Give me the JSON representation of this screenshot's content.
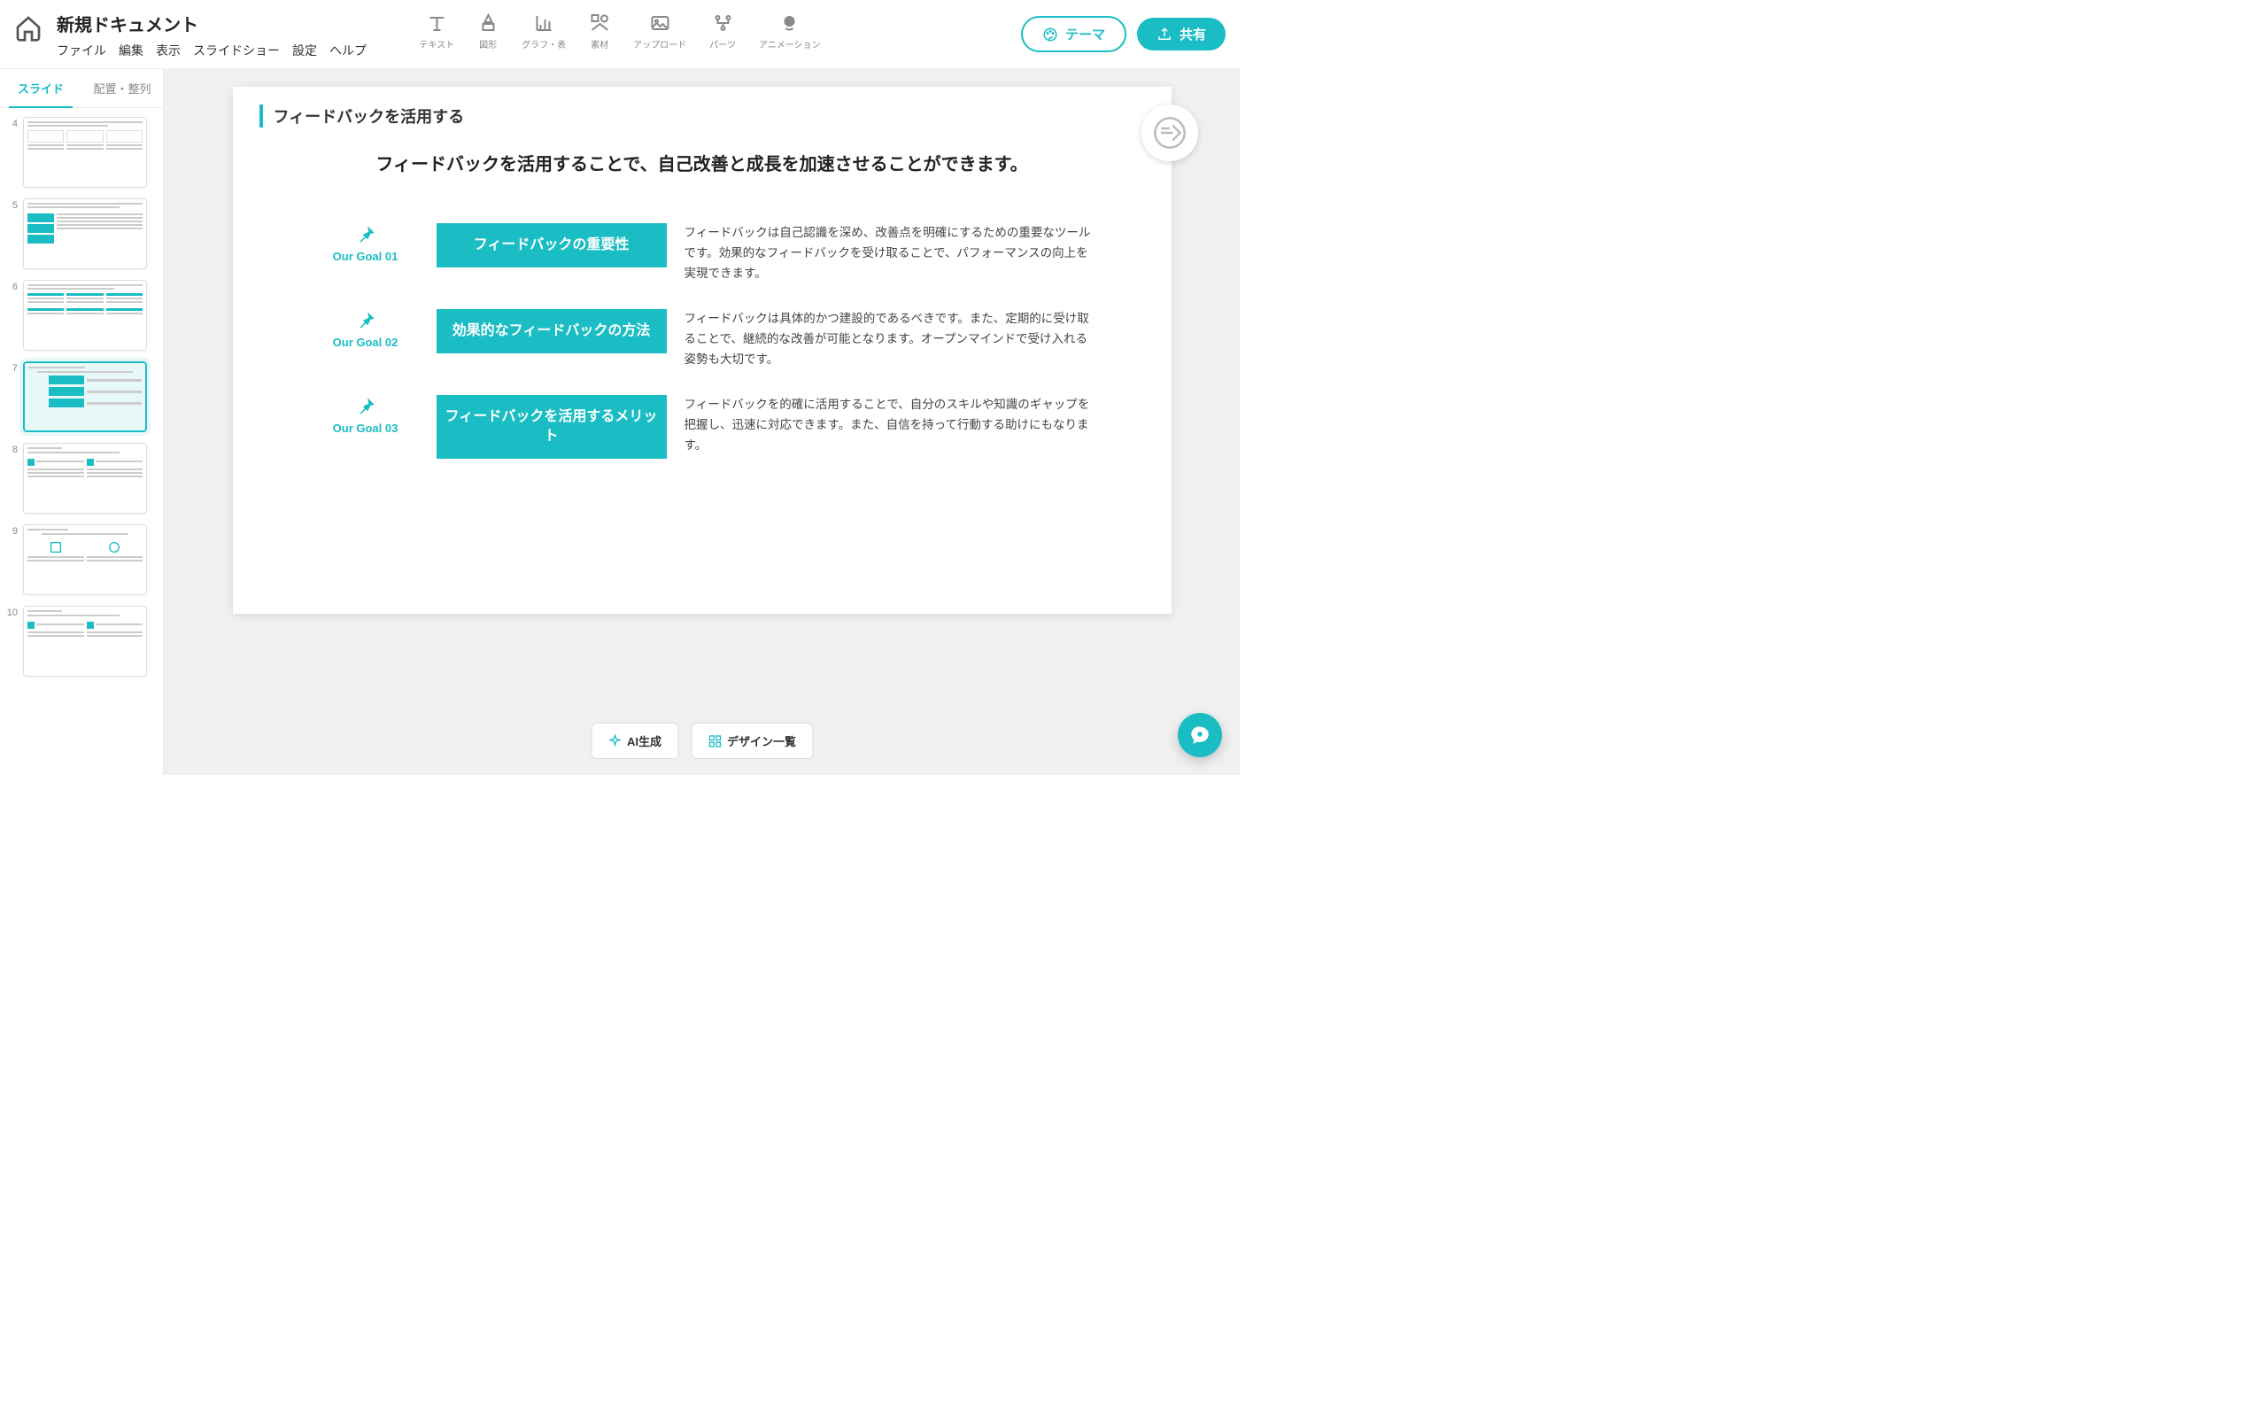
{
  "header": {
    "doc_title": "新規ドキュメント",
    "menu": {
      "file": "ファイル",
      "edit": "編集",
      "view": "表示",
      "slideshow": "スライドショー",
      "settings": "設定",
      "help": "ヘルプ"
    },
    "tools": {
      "text": "テキスト",
      "shape": "図形",
      "chart": "グラフ・表",
      "materials": "素材",
      "upload": "アップロード",
      "parts": "パーツ",
      "animation": "アニメーション"
    },
    "theme_btn": "テーマ",
    "share_btn": "共有"
  },
  "sidebar": {
    "tab_slide": "スライド",
    "tab_arrange": "配置・整列",
    "thumbs": [
      "4",
      "5",
      "6",
      "7",
      "8",
      "9",
      "10"
    ],
    "active_index": 3
  },
  "slide": {
    "subtitle": "フィードバックを活用する",
    "title": "フィードバックを活用することで、自己改善と成長を加速させることができます。",
    "goals": [
      {
        "num": "Our Goal 01",
        "box": "フィードバックの重要性",
        "desc": "フィードバックは自己認識を深め、改善点を明確にするための重要なツールです。効果的なフィードバックを受け取ることで、パフォーマンスの向上を実現できます。"
      },
      {
        "num": "Our Goal 02",
        "box": "効果的なフィードバックの方法",
        "desc": "フィードバックは具体的かつ建設的であるべきです。また、定期的に受け取ることで、継続的な改善が可能となります。オープンマインドで受け入れる姿勢も大切です。"
      },
      {
        "num": "Our Goal 03",
        "box": "フィードバックを活用するメリット",
        "desc": "フィードバックを的確に活用することで、自分のスキルや知識のギャップを把握し、迅速に対応できます。また、自信を持って行動する助けにもなります。"
      }
    ]
  },
  "bottom": {
    "ai_gen": "AI生成",
    "design_list": "デザイン一覧"
  }
}
